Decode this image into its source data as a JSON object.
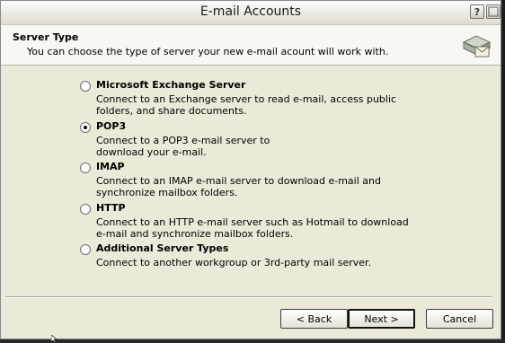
{
  "window": {
    "title": "E-mail Accounts"
  },
  "titlebar": {
    "help_label": "?",
    "close_label": ""
  },
  "header": {
    "title": "Server Type",
    "subtitle": "You can choose the type of server your new e-mail acount will work with."
  },
  "options": [
    {
      "label": "Microsoft Exchange Server",
      "description": "Connect to an Exchange server to read e-mail, access public folders, and share documents.",
      "selected": false
    },
    {
      "label": "POP3",
      "description": "Connect to a POP3 e-mail server to download your e-mail.",
      "selected": true
    },
    {
      "label": "IMAP",
      "description": "Connect to an IMAP e-mail server to download e-mail and synchronize mailbox folders.",
      "selected": false
    },
    {
      "label": "HTTP",
      "description": "Connect to an HTTP e-mail server such as Hotmail to download e-mail and synchronize mailbox folders.",
      "selected": false
    },
    {
      "label": "Additional Server Types",
      "description": "Connect to another workgroup or 3rd-party mail server.",
      "selected": false
    }
  ],
  "buttons": {
    "back": "< Back",
    "next": "Next >",
    "cancel": "Cancel"
  },
  "icons": {
    "header": "mail-server-icon",
    "help": "help-icon",
    "close": "close-icon",
    "cursor": "mouse-pointer-icon"
  }
}
